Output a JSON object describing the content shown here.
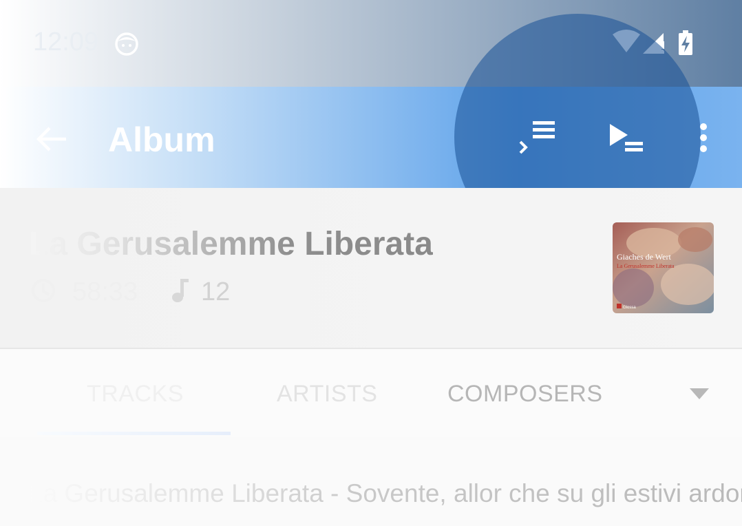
{
  "status_bar": {
    "time": "12:09"
  },
  "app_bar": {
    "title": "Album",
    "accent_color": "#1976d2"
  },
  "album": {
    "title": "La Gerusalemme Liberata",
    "duration": "58:33",
    "track_count": "12",
    "cover_artist": "Giaches de Wert",
    "cover_title": "La Gerusalemme Liberata",
    "cover_label": "Glossa"
  },
  "tabs": [
    {
      "label": "TRACKS",
      "selected": true
    },
    {
      "label": "ARTISTS",
      "selected": false
    },
    {
      "label": "COMPOSERS",
      "selected": false
    }
  ],
  "tracks": [
    {
      "title": "La Gerusalemme Liberata - Sovente, allor che su gli estivi ardori"
    }
  ],
  "icons": {
    "back": "arrow-back-icon",
    "add_to_queue": "add-to-queue-icon",
    "play_queue": "play-queue-icon",
    "more": "more-vert-icon",
    "duration": "clock-icon",
    "tracks": "music-note-icon",
    "dropdown": "dropdown-arrow-icon"
  }
}
